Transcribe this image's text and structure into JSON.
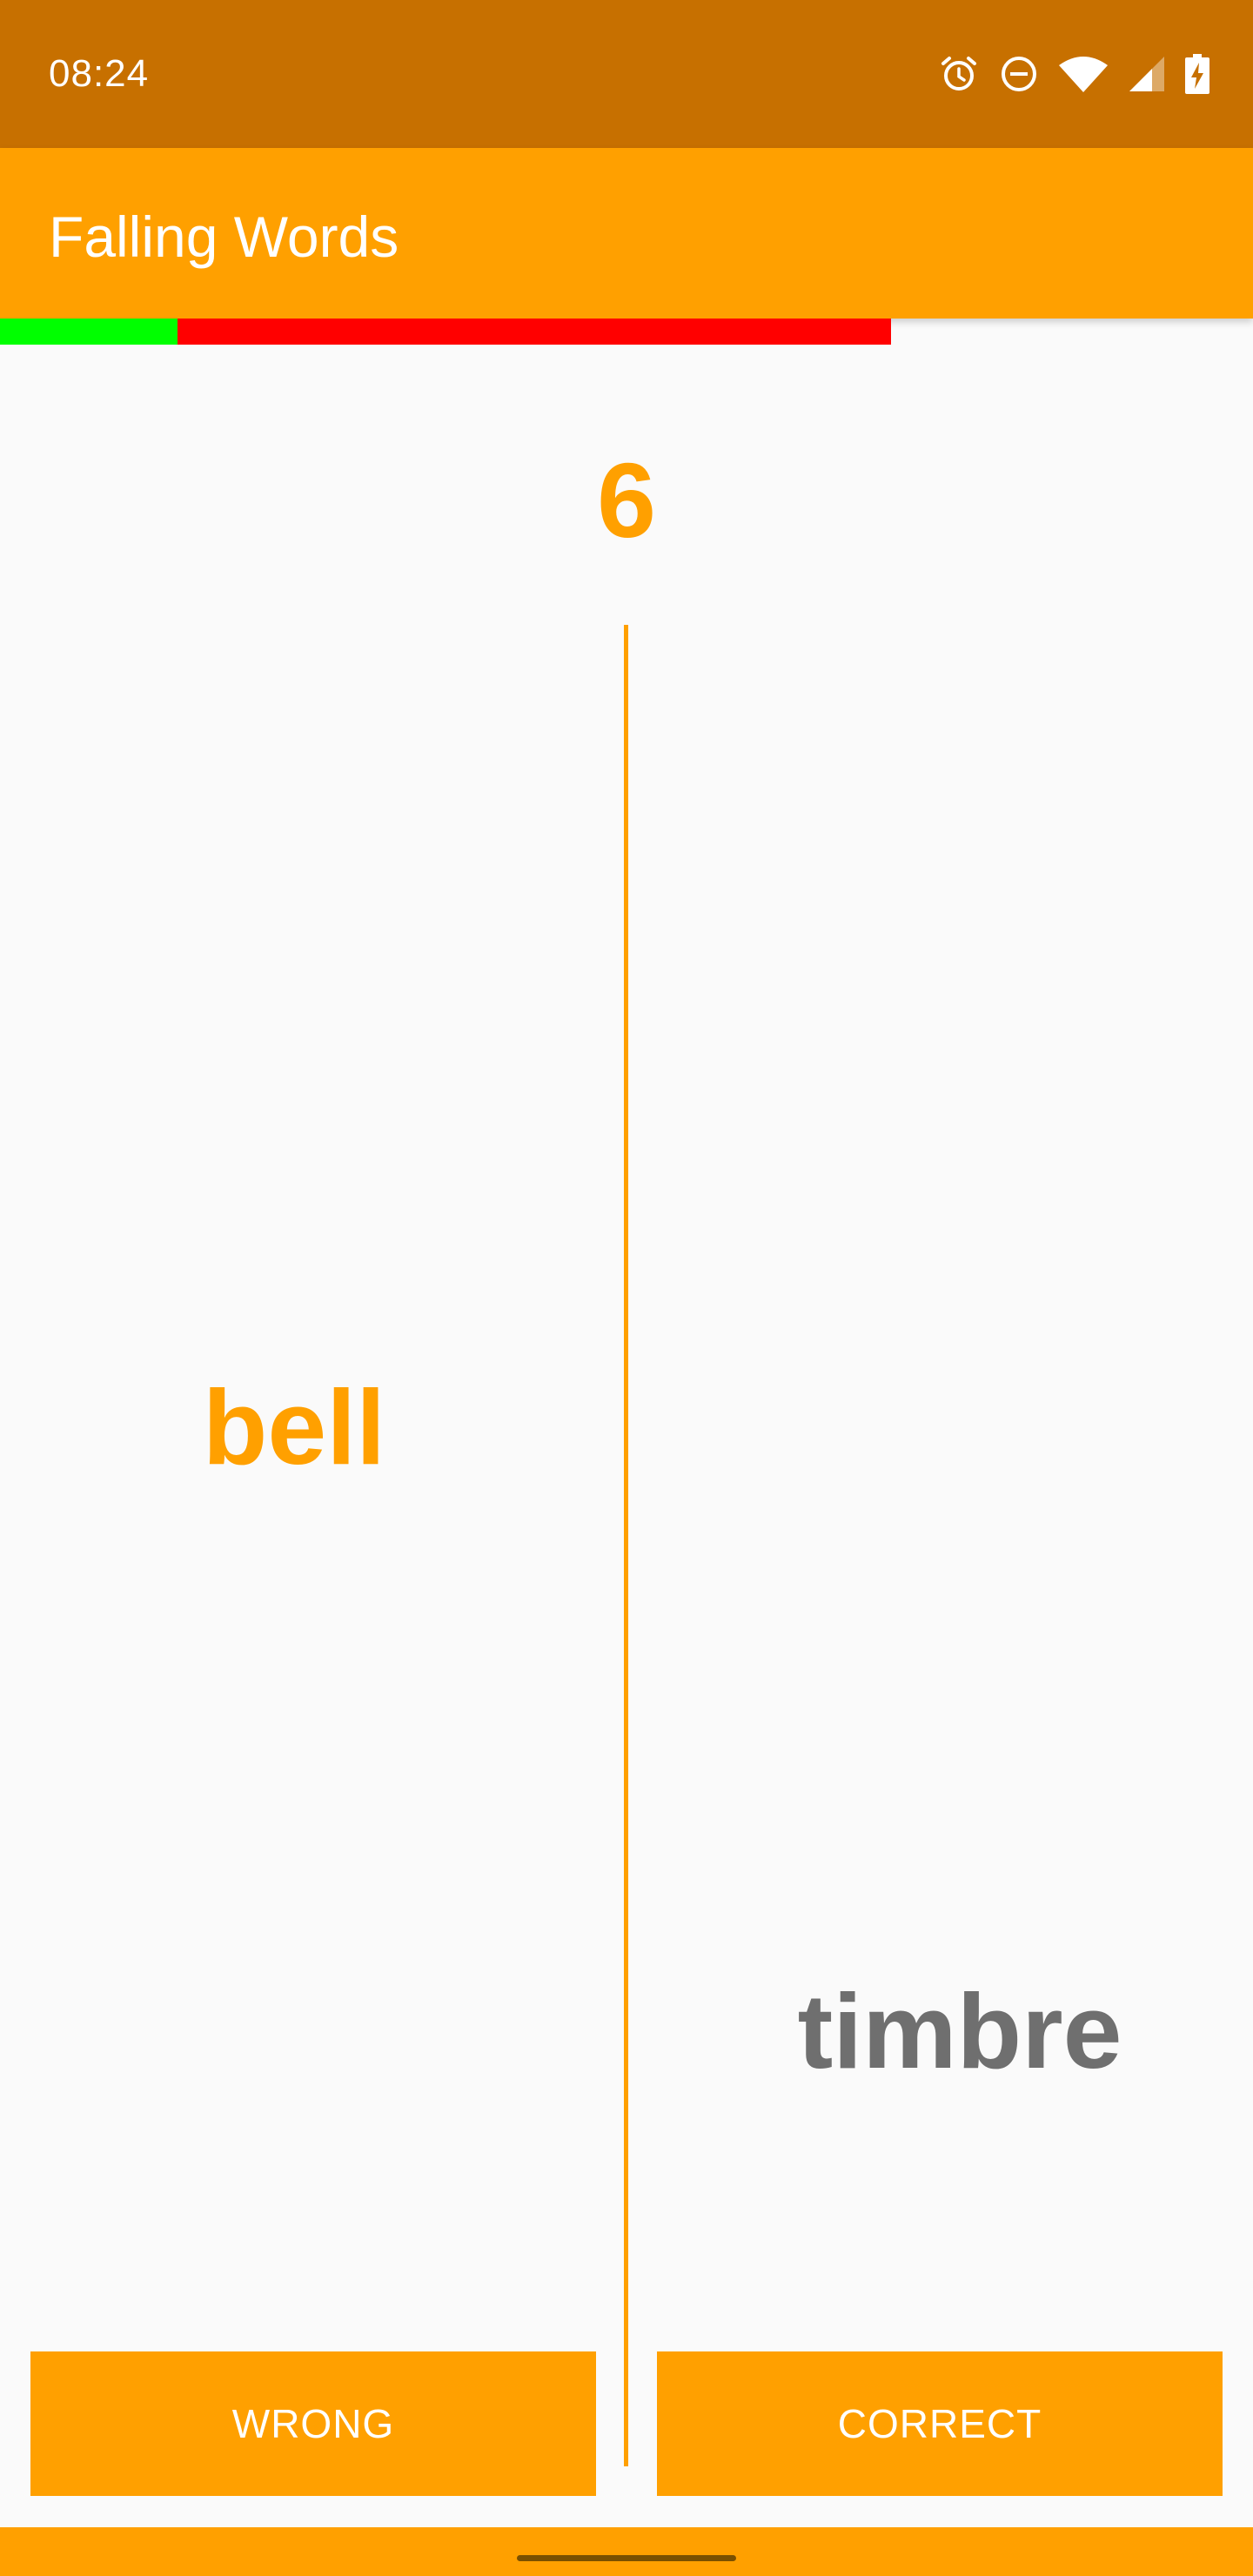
{
  "status_bar": {
    "time": "08:24",
    "icons": [
      "alarm-icon",
      "do-not-disturb-icon",
      "wifi-icon",
      "cellular-signal-icon",
      "battery-charging-icon"
    ]
  },
  "app_bar": {
    "title": "Falling Words"
  },
  "progress": {
    "correct_fraction": 0.1417,
    "wrong_fraction": 0.5694,
    "colors": {
      "correct": "#00ff00",
      "wrong": "#ff0000"
    }
  },
  "game": {
    "counter": "6",
    "falling_word": "bell",
    "translation_word": "timbre"
  },
  "buttons": {
    "wrong_label": "WRONG",
    "correct_label": "CORRECT"
  },
  "colors": {
    "accent": "#ffa000",
    "status_bar": "#c77000",
    "background": "#fafafa",
    "translation_text": "#6f6f6f"
  }
}
